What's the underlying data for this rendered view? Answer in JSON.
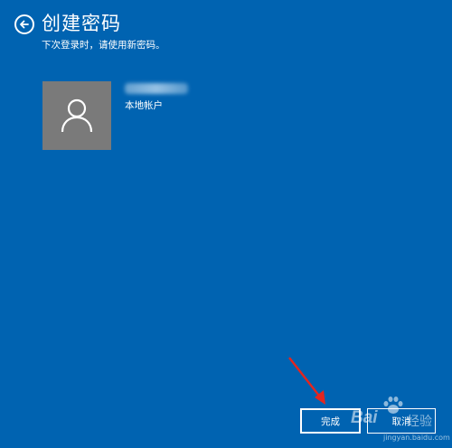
{
  "header": {
    "back_icon": "back-arrow-icon",
    "title": "创建密码",
    "subtitle": "下次登录时，请使用新密码。"
  },
  "account": {
    "avatar_icon": "user-icon",
    "account_type": "本地帐户"
  },
  "footer": {
    "finish_label": "完成",
    "cancel_label": "取消"
  },
  "watermark": {
    "brand": "Bai",
    "brand_cn": "经验",
    "url": "jingyan.baidu.com"
  },
  "colors": {
    "background": "#0063b1",
    "avatar_bg": "#7a7a7a",
    "annotation_arrow": "#e5251e"
  }
}
